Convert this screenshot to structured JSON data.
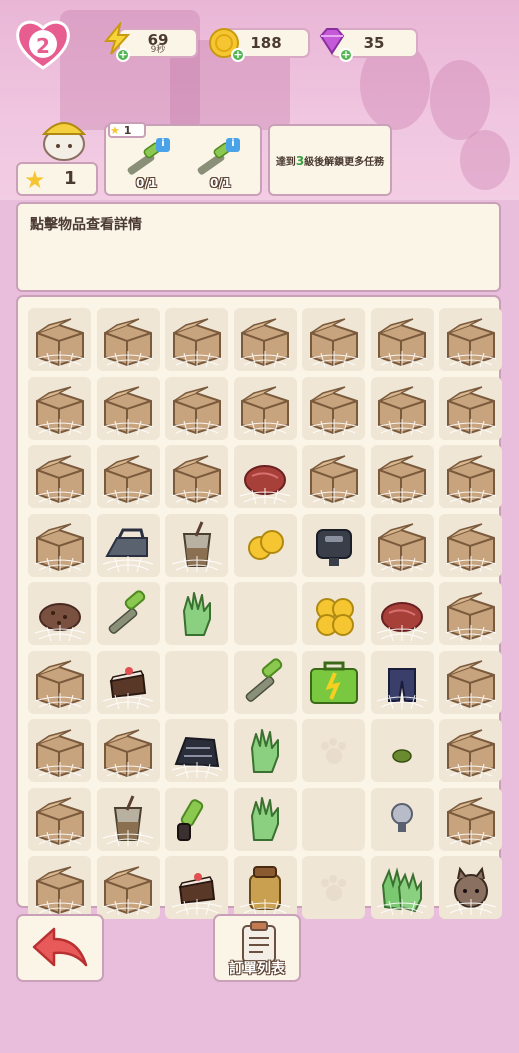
{
  "hud": {
    "level": "2",
    "energy_value": "69",
    "energy_timer": "9秒",
    "coins_value": "188",
    "gems_value": "35"
  },
  "player": {
    "stars": "1"
  },
  "task": {
    "star_badge": "1",
    "items": [
      {
        "progress": "0/1",
        "icon": "wrench-icon"
      },
      {
        "progress": "0/1",
        "icon": "wrench-icon"
      }
    ]
  },
  "locked_task": {
    "text_before": "達到",
    "level": "3",
    "text_after": "級後解鎖更多任務"
  },
  "info": {
    "text": "點擊物品查看詳情"
  },
  "board": {
    "rows": [
      [
        "box",
        "box",
        "box",
        "box",
        "box",
        "box",
        "box"
      ],
      [
        "box",
        "box",
        "box",
        "box",
        "box",
        "box",
        "box"
      ],
      [
        "box",
        "box",
        "box",
        "steak",
        "box",
        "box",
        "box"
      ],
      [
        "box",
        "iron",
        "cup",
        "coins2",
        "toaster",
        "box",
        "box"
      ],
      [
        "cookie",
        "wrench",
        "glove",
        "empty",
        "coins4",
        "steak",
        "box"
      ],
      [
        "box",
        "cake",
        "empty",
        "wrench",
        "toolbox",
        "pants",
        "box"
      ],
      [
        "box",
        "box",
        "trap",
        "glove",
        "paw",
        "bean",
        "box"
      ],
      [
        "box",
        "cup",
        "handle",
        "glove",
        "empty",
        "bulb",
        "box"
      ],
      [
        "box",
        "box",
        "cake",
        "jar",
        "paw",
        "gloves",
        "cat"
      ]
    ],
    "webbed": [
      [
        1,
        1,
        1,
        1,
        1,
        1,
        1
      ],
      [
        1,
        1,
        1,
        1,
        1,
        1,
        1
      ],
      [
        1,
        1,
        1,
        1,
        1,
        1,
        1
      ],
      [
        1,
        1,
        1,
        0,
        0,
        1,
        1
      ],
      [
        1,
        0,
        0,
        0,
        0,
        1,
        1
      ],
      [
        1,
        1,
        0,
        0,
        0,
        1,
        1
      ],
      [
        1,
        1,
        1,
        0,
        0,
        0,
        1
      ],
      [
        1,
        1,
        0,
        0,
        0,
        0,
        1
      ],
      [
        1,
        1,
        1,
        1,
        0,
        1,
        1
      ]
    ]
  },
  "footer": {
    "orders_label": "訂單列表"
  },
  "colors": {
    "background": "#e8bedc",
    "panel": "#fbf5e8",
    "panel_border": "#c9a0b8",
    "box": "#b99a78",
    "accent_green": "#52b552",
    "back_arrow": "#e85a5a"
  }
}
